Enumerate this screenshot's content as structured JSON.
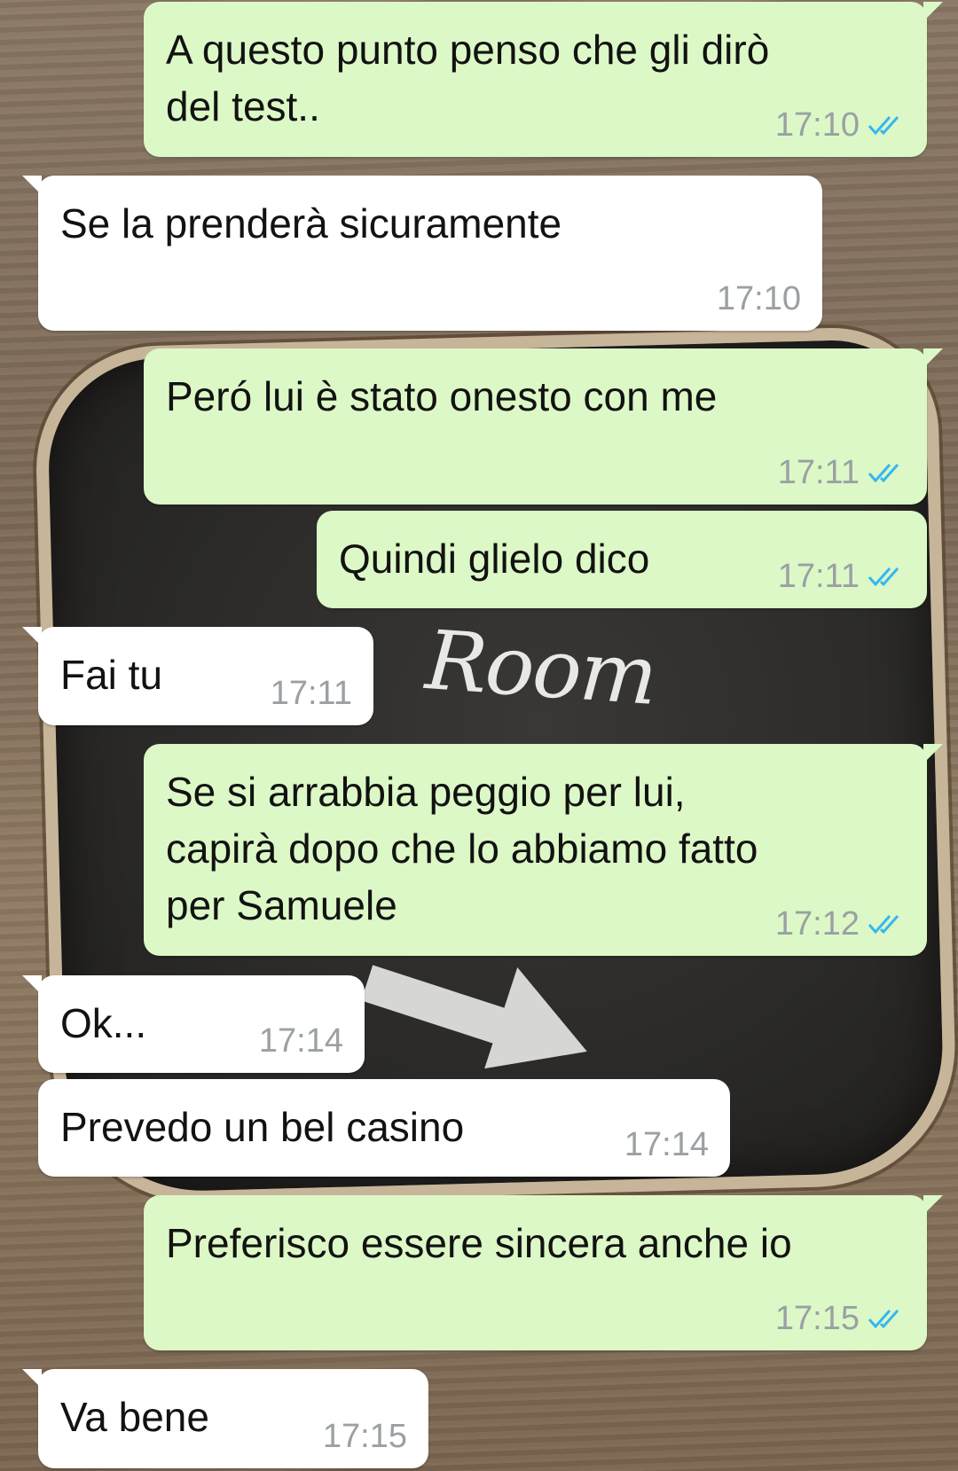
{
  "colors": {
    "outgoing_bubble": "#dcf8c6",
    "incoming_bubble": "#ffffff",
    "read_tick": "#34b7f1",
    "timestamp": "#9aa0a3"
  },
  "wallpaper": {
    "board_text": "Room"
  },
  "messages": [
    {
      "dir": "out",
      "text": "A questo punto penso che gli dirò\ndel test..",
      "time": "17:10",
      "status_icon": "double-check-read-icon"
    },
    {
      "dir": "in",
      "text": "Se la prenderà sicuramente",
      "time": "17:10"
    },
    {
      "dir": "out",
      "text": "Peró lui è stato onesto con me",
      "time": "17:11",
      "status_icon": "double-check-read-icon"
    },
    {
      "dir": "out",
      "text": "Quindi glielo dico",
      "time": "17:11",
      "status_icon": "double-check-read-icon"
    },
    {
      "dir": "in",
      "text": "Fai tu",
      "time": "17:11"
    },
    {
      "dir": "out",
      "text": "Se si arrabbia peggio per lui,\ncapirà dopo che lo abbiamo fatto\nper Samuele",
      "time": "17:12",
      "status_icon": "double-check-read-icon"
    },
    {
      "dir": "in",
      "text": "Ok...",
      "time": "17:14"
    },
    {
      "dir": "in",
      "text": "Prevedo un bel casino",
      "time": "17:14"
    },
    {
      "dir": "out",
      "text": "Preferisco essere sincera anche io",
      "time": "17:15",
      "status_icon": "double-check-read-icon"
    },
    {
      "dir": "in",
      "text": "Va bene",
      "time": "17:15"
    }
  ]
}
